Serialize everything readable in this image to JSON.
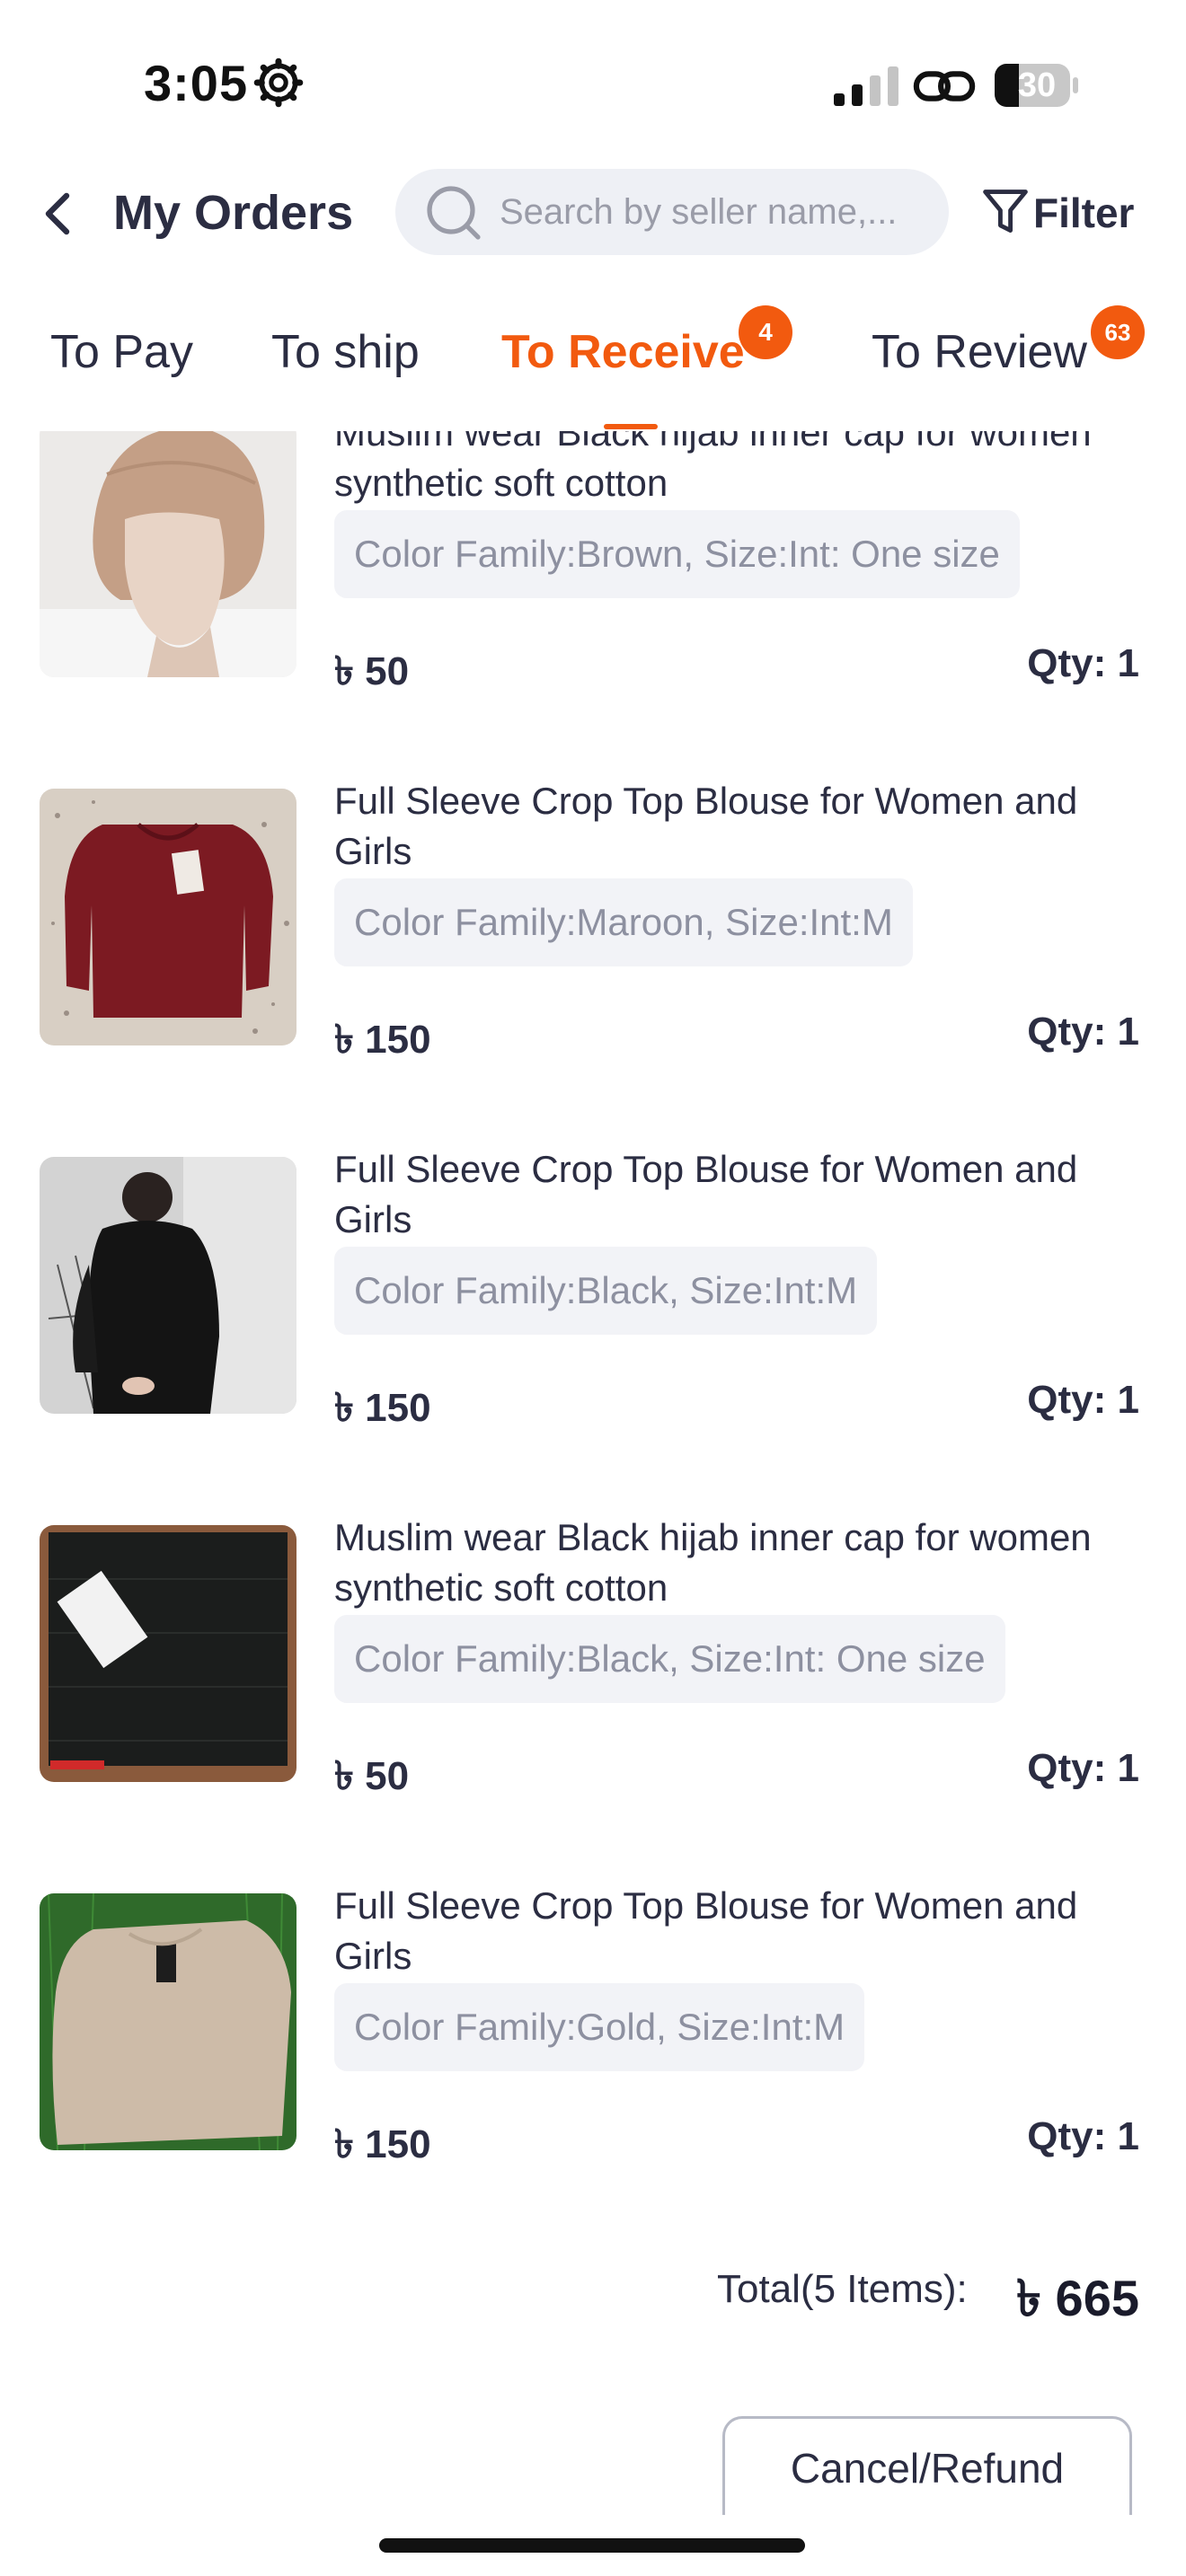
{
  "status_bar": {
    "time": "3:05",
    "battery": "30",
    "icons": [
      "gear-icon",
      "signal-icon",
      "link-icon",
      "battery-icon"
    ]
  },
  "header": {
    "title": "My Orders",
    "search_placeholder": "Search by seller name,...",
    "filter_label": "Filter",
    "icons": [
      "back-icon",
      "search-icon",
      "filter-icon"
    ]
  },
  "tabs": [
    {
      "label": "To Pay"
    },
    {
      "label": "To ship"
    },
    {
      "label": "To Receive",
      "badge": "4",
      "active": true
    },
    {
      "label": "To Review",
      "badge": "63"
    }
  ],
  "accent_color": "#f25a0f",
  "items": [
    {
      "name": "Muslim wear Black hijab inner cap for women synthetic soft cotton",
      "variant": "Color Family:Brown, Size:Int: One size",
      "price": "৳ 50",
      "qty": "Qty: 1"
    },
    {
      "name": "Full Sleeve Crop Top Blouse for Women and Girls",
      "variant": "Color Family:Maroon, Size:Int:M",
      "price": "৳ 150",
      "qty": "Qty: 1"
    },
    {
      "name": "Full Sleeve Crop Top Blouse for Women and Girls",
      "variant": "Color Family:Black, Size:Int:M",
      "price": "৳ 150",
      "qty": "Qty: 1"
    },
    {
      "name": "Muslim wear Black hijab inner cap for women synthetic soft cotton",
      "variant": "Color Family:Black, Size:Int: One size",
      "price": "৳ 50",
      "qty": "Qty: 1"
    },
    {
      "name": "Full Sleeve Crop Top Blouse for Women and Girls",
      "variant": "Color Family:Gold, Size:Int:M",
      "price": "৳ 150",
      "qty": "Qty: 1"
    }
  ],
  "summary": {
    "total_label": "Total(5 Items):",
    "total_value": "৳ 665"
  },
  "actions": {
    "cancel_refund": "Cancel/Refund"
  }
}
